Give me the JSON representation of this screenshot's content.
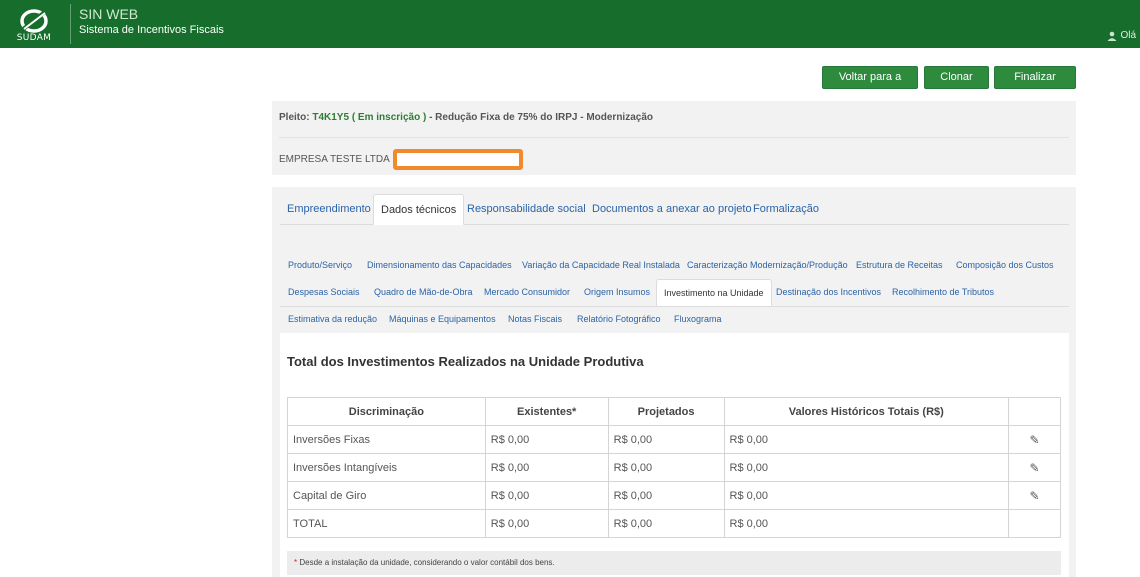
{
  "header": {
    "logo_text": "SUDAM",
    "app_title": "SIN WEB",
    "app_subtitle": "Sistema de Incentivos Fiscais",
    "user_greeting": "Olá",
    "background_color": "#166d2c"
  },
  "actions": {
    "voltar": "Voltar para a lista",
    "clonar": "Clonar Pleito",
    "finalizar": "Finalizar pleito"
  },
  "pleito": {
    "label": "Pleito:",
    "code": "T4K1Y5",
    "status": "( Em inscrição )",
    "description": "- Redução Fixa de 75% do IRPJ - Modernização",
    "empresa": "EMPRESA TESTE LTDA"
  },
  "tabs": [
    {
      "label": "Empreendimento",
      "active": false
    },
    {
      "label": "Dados técnicos",
      "active": true
    },
    {
      "label": "Responsabilidade social",
      "active": false
    },
    {
      "label": "Documentos a anexar ao projeto",
      "active": false
    },
    {
      "label": "Formalização",
      "active": false
    }
  ],
  "subtabs": {
    "row1": [
      "Produto/Serviço",
      "Dimensionamento das Capacidades",
      "Variação da Capacidade Real Instalada",
      "Caracterização Modernização/Produção",
      "Estrutura de Receitas",
      "Composição dos Custos"
    ],
    "row2": [
      "Despesas Sociais",
      "Quadro de Mão-de-Obra",
      "Mercado Consumidor",
      "Origem Insumos",
      "Investimento na Unidade",
      "Destinação dos Incentivos",
      "Recolhimento de Tributos"
    ],
    "row3": [
      "Estimativa da redução",
      "Máquinas e Equipamentos",
      "Notas Fiscais",
      "Relatório Fotográfico",
      "Fluxograma"
    ],
    "active": "Investimento na Unidade"
  },
  "section": {
    "title": "Total dos Investimentos Realizados na Unidade Produtiva"
  },
  "table": {
    "headers": [
      "Discriminação",
      "Existentes*",
      "Projetados",
      "Valores Históricos Totais (R$)"
    ],
    "rows": [
      {
        "label": "Inversões Fixas",
        "existentes": "R$ 0,00",
        "projetados": "R$ 0,00",
        "historicos": "R$ 0,00",
        "editable": true
      },
      {
        "label": "Inversões Intangíveis",
        "existentes": "R$ 0,00",
        "projetados": "R$ 0,00",
        "historicos": "R$ 0,00",
        "editable": true
      },
      {
        "label": "Capital de Giro",
        "existentes": "R$ 0,00",
        "projetados": "R$ 0,00",
        "historicos": "R$ 0,00",
        "editable": true
      },
      {
        "label": "TOTAL",
        "existentes": "R$ 0,00",
        "projetados": "R$ 0,00",
        "historicos": "R$ 0,00",
        "editable": false
      }
    ]
  },
  "footnote": {
    "marker": "*",
    "text": "Desde a instalação da unidade, considerando o valor contábil dos bens."
  },
  "icons": {
    "logo": "sudam-logo-icon",
    "user": "user-icon",
    "edit": "pencil-icon"
  }
}
